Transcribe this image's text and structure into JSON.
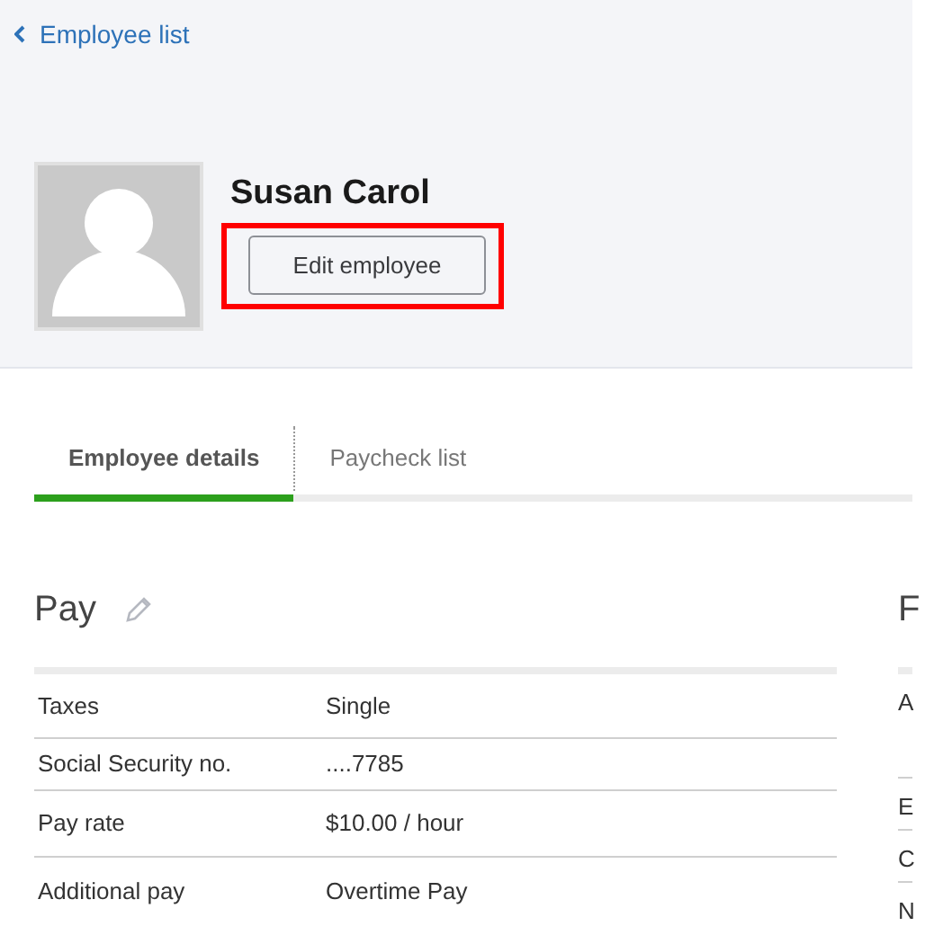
{
  "back_link": {
    "label": "Employee list"
  },
  "employee": {
    "name": "Susan Carol",
    "edit_button": "Edit employee",
    "highlighted": true
  },
  "tabs": [
    {
      "label": "Employee details",
      "selected": true
    },
    {
      "label": "Paycheck list",
      "selected": false
    }
  ],
  "pay": {
    "title": "Pay",
    "rows": [
      {
        "label": "Taxes",
        "value": "Single"
      },
      {
        "label": "Social Security no.",
        "value": "....7785"
      },
      {
        "label": "Pay rate",
        "value": "$10.00 / hour"
      },
      {
        "label": "Additional pay",
        "value": "Overtime Pay"
      }
    ]
  },
  "side_section": {
    "title": "F",
    "rows": [
      "A",
      "E",
      "C",
      "N"
    ]
  }
}
